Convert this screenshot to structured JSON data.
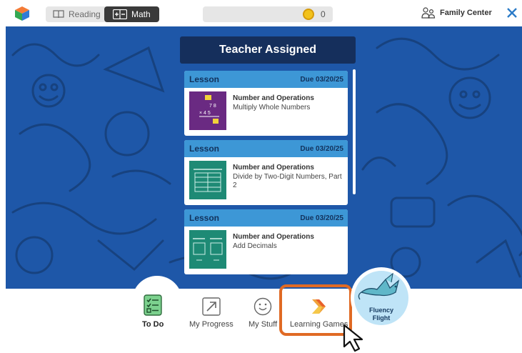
{
  "topbar": {
    "subject_toggle": {
      "reading_label": "Reading",
      "math_label": "Math",
      "selected": "Math"
    },
    "coins": {
      "count": "0"
    },
    "family_center_label": "Family Center"
  },
  "panel": {
    "title": "Teacher Assigned",
    "cards": [
      {
        "type": "Lesson",
        "due": "Due 03/20/25",
        "category": "Number and Operations",
        "title": "Multiply Whole Numbers",
        "thumb_color": "#6a2a82"
      },
      {
        "type": "Lesson",
        "due": "Due 03/20/25",
        "category": "Number and Operations",
        "title": "Divide by Two-Digit Numbers, Part 2",
        "thumb_color": "#1e8a75"
      },
      {
        "type": "Lesson",
        "due": "Due 03/20/25",
        "category": "Number and Operations",
        "title": "Add Decimals",
        "thumb_color": "#1e8a75"
      }
    ]
  },
  "bottom_nav": {
    "items": [
      {
        "label": "To Do",
        "icon": "checklist-icon",
        "active": true
      },
      {
        "label": "My Progress",
        "icon": "progress-arrow-icon",
        "active": false
      },
      {
        "label": "My Stuff",
        "icon": "smiley-icon",
        "active": false
      },
      {
        "label": "Learning Games",
        "icon": "games-chevron-icon",
        "active": false
      }
    ],
    "fluency_flight": {
      "label_line1": "Fluency",
      "label_line2": "Flight",
      "icon": "dragon-icon"
    }
  },
  "colors": {
    "stage_blue": "#1e57a8",
    "panel_title_bg": "#152f5c",
    "card_header": "#3d97d6",
    "highlight_orange": "#e06a24",
    "coin_gold": "#f2c21c"
  }
}
